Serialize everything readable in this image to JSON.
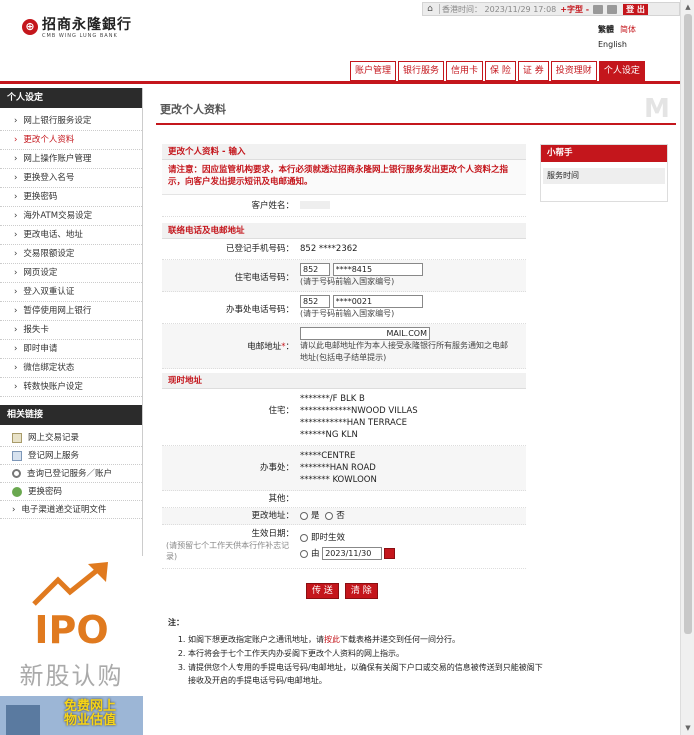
{
  "bank": {
    "name_cn": "招商永隆銀行",
    "name_en": "CMB WING LUNG BANK"
  },
  "topbar": {
    "time": "香港时间： 2023/11/29 17:08",
    "font_size_label": "+字型 -",
    "logout": "登 出"
  },
  "lang": {
    "traditional": "繁體",
    "simplified": "简体",
    "english": "English"
  },
  "nav": {
    "tabs": [
      "账户管理",
      "银行服务",
      "信用卡",
      "保 险",
      "证 券",
      "投资理财",
      "个人设定"
    ],
    "active_index": 6
  },
  "sidebar": {
    "title": "个人设定",
    "items": [
      "网上银行服务设定",
      "更改个人资料",
      "网上操作账户管理",
      "更换登入名号",
      "更换密码",
      "海外ATM交易设定",
      "更改电话、地址",
      "交易限额设定",
      "网页设定",
      "登入双重认证",
      "暂停使用网上银行",
      "报失卡",
      "即时申请",
      "微信绑定状态",
      "转数快账户设定"
    ],
    "active_index": 1,
    "related_title": "相关链接",
    "related": [
      {
        "label": "网上交易记录",
        "icon": "document-icon"
      },
      {
        "label": "登记网上服务",
        "icon": "list-icon"
      },
      {
        "label": "查询已登记服务／账户",
        "icon": "search-icon"
      },
      {
        "label": "更换密码",
        "icon": "user-icon"
      },
      {
        "label": "电子渠道递交证明文件",
        "icon": "arrow-icon"
      }
    ]
  },
  "banner": {
    "ipo": "IPO",
    "ipo_cn": "新股认购",
    "promo": "免费网上\n物业估值"
  },
  "content": {
    "page_title": "更改个人资料",
    "section1_title": "更改个人资料 - 输入",
    "warning": "请注意：因应监管机构要求，本行必须就透过招商永隆网上银行服务发出更改个人资料之指示，向客户发出提示短讯及电邮通知。",
    "customer_name_label": "客户姓名：",
    "customer_name_value": "",
    "section2_title": "联络电话及电邮地址",
    "mobile_label": "已登记手机号码：",
    "mobile_value": "852 ****2362",
    "home_phone_label": "住宅电话号码：",
    "home_phone_cc": "852",
    "home_phone_no": "****8415",
    "home_phone_hint": "(请于号码前输入国家编号)",
    "office_phone_label": "办事处电话号码：",
    "office_phone_cc": "852",
    "office_phone_no": "****0021",
    "office_phone_hint": "(请于号码前输入国家编号)",
    "email_label": "电邮地址",
    "email_required": "*",
    "email_colon": "：",
    "email_value": "MAIL.COM",
    "email_hint": "请以此电邮地址作为本人接受永隆银行所有服务通知之电邮地址(包括电子结单提示)",
    "section3_title": "现时地址",
    "home_addr_label": "住宅：",
    "home_addr": [
      "*******/F BLK B",
      "************NWOOD VILLAS",
      "***********HAN TERRACE",
      "******NG KLN"
    ],
    "office_addr_label": "办事处：",
    "office_addr": [
      "*****CENTRE",
      "*******HAN ROAD",
      "******* KOWLOON"
    ],
    "other_label": "其他：",
    "change_addr_label": "更改地址：",
    "yes": "是",
    "no": "否",
    "effective_label": "生效日期：",
    "effective_note": "(请预留七个工作天供本行作补志记录)",
    "immediate": "即时生效",
    "from": "由",
    "from_date": "2023/11/30"
  },
  "helper": {
    "title": "小帮手",
    "item": "服务时间"
  },
  "buttons": {
    "submit": "传 送",
    "clear": "清 除"
  },
  "notes": {
    "heading": "注：",
    "items": [
      {
        "pre": "如阁下想更改指定账户之通讯地址，请",
        "link": "按此",
        "post": "下载表格并递交到任何一间分行。"
      },
      {
        "pre": "本行将会于七个工作天内办妥阁下更改个人资料的网上指示。",
        "link": "",
        "post": ""
      },
      {
        "pre": "请提供您个人专用的手提电话号码/电邮地址，以确保有关阁下户口或交易的信息被传送到只能被阁下接收及开启的手提电话号码/电邮地址。",
        "link": "",
        "post": ""
      }
    ]
  }
}
